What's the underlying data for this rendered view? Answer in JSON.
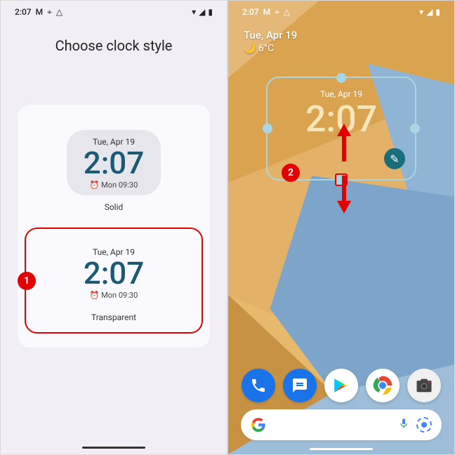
{
  "status": {
    "time": "2:07"
  },
  "left": {
    "title": "Choose clock style",
    "options": [
      {
        "date": "Tue, Apr 19",
        "time": "2:07",
        "alarm": "⏰ Mon 09:30",
        "label": "Solid"
      },
      {
        "date": "Tue, Apr 19",
        "time": "2:07",
        "alarm": "⏰ Mon 09:30",
        "label": "Transparent"
      }
    ]
  },
  "marker": {
    "one": "1",
    "two": "2"
  },
  "right": {
    "date": "Tue, Apr 19",
    "weather": "🌙 6°C",
    "widget": {
      "date": "Tue, Apr 19",
      "time": "2:07"
    }
  }
}
